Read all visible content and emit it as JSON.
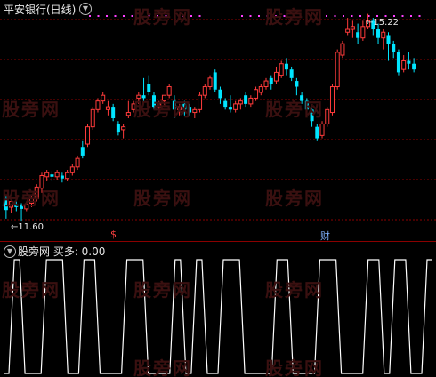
{
  "top_panel": {
    "title": "平安银行(日线)",
    "chevron_icon": "chevron-down-icon",
    "high_label": "15.22",
    "low_label": "11.60",
    "event_markers": [
      {
        "text": "$",
        "color": "#ff4040"
      },
      {
        "text": "财",
        "color": "#7fb0ff"
      }
    ],
    "colors": {
      "up": "#ff3b3b",
      "down": "#00e5ff",
      "grid": "#8b0000",
      "dot": "#ff40ff"
    }
  },
  "bottom_panel": {
    "title": "股旁网 买多: 0.00",
    "chevron_icon": "chevron-down-icon",
    "signal_color": "#ffffff"
  },
  "watermark": "股旁网",
  "chart_data": {
    "type": "candlestick",
    "ylim": [
      11.4,
      15.4
    ],
    "high": 15.22,
    "low": 11.6,
    "candles": [
      [
        12.0,
        11.8,
        12.05,
        11.65
      ],
      [
        11.85,
        11.95,
        12.0,
        11.75
      ],
      [
        11.9,
        11.85,
        11.95,
        11.78
      ],
      [
        11.88,
        11.82,
        11.92,
        11.6
      ],
      [
        11.82,
        11.9,
        11.95,
        11.78
      ],
      [
        11.92,
        12.0,
        12.05,
        11.85
      ],
      [
        12.0,
        12.2,
        12.25,
        11.95
      ],
      [
        12.18,
        12.4,
        12.45,
        12.1
      ],
      [
        12.38,
        12.45,
        12.5,
        12.3
      ],
      [
        12.42,
        12.38,
        12.48,
        12.3
      ],
      [
        12.38,
        12.45,
        12.5,
        12.32
      ],
      [
        12.4,
        12.35,
        12.45,
        12.28
      ],
      [
        12.35,
        12.45,
        12.5,
        12.3
      ],
      [
        12.45,
        12.55,
        12.6,
        12.4
      ],
      [
        12.55,
        12.7,
        12.75,
        12.5
      ],
      [
        12.9,
        12.75,
        13.0,
        12.7
      ],
      [
        12.95,
        13.25,
        13.3,
        12.9
      ],
      [
        13.25,
        13.55,
        13.6,
        13.2
      ],
      [
        13.55,
        13.7,
        13.75,
        13.5
      ],
      [
        13.7,
        13.8,
        13.85,
        13.65
      ],
      [
        13.55,
        13.6,
        13.7,
        13.45
      ],
      [
        13.6,
        13.4,
        13.65,
        13.35
      ],
      [
        13.3,
        13.15,
        13.35,
        13.1
      ],
      [
        13.2,
        13.25,
        13.3,
        13.05
      ],
      [
        13.45,
        13.5,
        13.7,
        13.4
      ],
      [
        13.55,
        13.65,
        13.7,
        13.5
      ],
      [
        13.75,
        13.8,
        13.85,
        13.65
      ],
      [
        13.8,
        13.75,
        14.1,
        13.7
      ],
      [
        14.0,
        13.85,
        14.15,
        13.8
      ],
      [
        13.8,
        13.6,
        13.85,
        13.55
      ],
      [
        13.6,
        13.65,
        13.7,
        13.55
      ],
      [
        13.7,
        13.8,
        13.8,
        13.6
      ],
      [
        13.8,
        13.95,
        14.0,
        13.75
      ],
      [
        13.7,
        13.55,
        13.8,
        13.4
      ],
      [
        13.55,
        13.6,
        13.65,
        13.45
      ],
      [
        13.65,
        13.55,
        13.7,
        13.45
      ],
      [
        13.6,
        13.5,
        13.65,
        13.45
      ],
      [
        13.5,
        13.55,
        13.6,
        13.4
      ],
      [
        13.55,
        13.8,
        13.85,
        13.5
      ],
      [
        13.8,
        13.95,
        14.0,
        13.75
      ],
      [
        13.95,
        14.1,
        14.15,
        13.9
      ],
      [
        14.2,
        13.9,
        14.25,
        13.85
      ],
      [
        13.9,
        13.75,
        13.95,
        13.65
      ],
      [
        13.7,
        13.6,
        13.75,
        13.55
      ],
      [
        13.6,
        13.55,
        13.8,
        13.5
      ],
      [
        13.55,
        13.65,
        13.7,
        13.5
      ],
      [
        13.65,
        13.7,
        13.75,
        13.55
      ],
      [
        13.8,
        13.65,
        13.85,
        13.6
      ],
      [
        13.65,
        13.75,
        13.8,
        13.6
      ],
      [
        13.75,
        13.9,
        13.95,
        13.7
      ],
      [
        13.85,
        13.95,
        14.0,
        13.8
      ],
      [
        13.95,
        14.05,
        14.1,
        13.9
      ],
      [
        14.1,
        14.0,
        14.15,
        13.9
      ],
      [
        14.05,
        14.2,
        14.3,
        14.0
      ],
      [
        14.15,
        14.35,
        14.4,
        14.1
      ],
      [
        14.35,
        14.25,
        14.45,
        14.15
      ],
      [
        14.25,
        14.1,
        14.3,
        14.05
      ],
      [
        14.05,
        13.95,
        14.1,
        13.8
      ],
      [
        13.8,
        13.7,
        13.85,
        13.65
      ],
      [
        13.7,
        13.55,
        13.75,
        13.5
      ],
      [
        13.55,
        13.35,
        13.6,
        13.25
      ],
      [
        13.25,
        13.05,
        13.3,
        13.0
      ],
      [
        13.1,
        13.3,
        13.35,
        13.05
      ],
      [
        13.3,
        13.55,
        13.6,
        13.25
      ],
      [
        13.5,
        13.95,
        14.0,
        13.45
      ],
      [
        13.95,
        14.55,
        14.6,
        13.9
      ],
      [
        14.5,
        14.7,
        14.75,
        14.45
      ],
      [
        14.9,
        14.95,
        15.15,
        14.85
      ],
      [
        14.95,
        15.0,
        15.1,
        14.8
      ],
      [
        14.9,
        14.8,
        15.05,
        14.7
      ],
      [
        14.8,
        15.0,
        15.1,
        14.75
      ],
      [
        15.0,
        15.1,
        15.22,
        14.95
      ],
      [
        15.1,
        14.95,
        15.15,
        14.85
      ],
      [
        14.95,
        14.8,
        15.05,
        14.7
      ],
      [
        14.8,
        14.9,
        14.95,
        14.6
      ],
      [
        14.85,
        14.7,
        14.9,
        14.4
      ],
      [
        14.7,
        14.55,
        14.75,
        14.45
      ],
      [
        14.55,
        14.2,
        14.6,
        14.15
      ],
      [
        14.25,
        14.4,
        14.5,
        14.2
      ],
      [
        14.4,
        14.35,
        14.55,
        14.25
      ],
      [
        14.35,
        14.25,
        14.45,
        14.2
      ]
    ],
    "signal": [
      0,
      0,
      1,
      1,
      0,
      0,
      0,
      0,
      1,
      1,
      1,
      1,
      0,
      0,
      0,
      1,
      1,
      1,
      0,
      0,
      0,
      0,
      0,
      1,
      1,
      1,
      1,
      0,
      0,
      0,
      0,
      0,
      1,
      1,
      0,
      0,
      1,
      1,
      0,
      0,
      0,
      1,
      1,
      1,
      1,
      0,
      0,
      0,
      0,
      0,
      0,
      1,
      1,
      1,
      0,
      0,
      0,
      0,
      0,
      1,
      1,
      1,
      1,
      0,
      0,
      0,
      0,
      0,
      1,
      1,
      1,
      0,
      0,
      1,
      1,
      1,
      0,
      0,
      0,
      1,
      1
    ]
  }
}
